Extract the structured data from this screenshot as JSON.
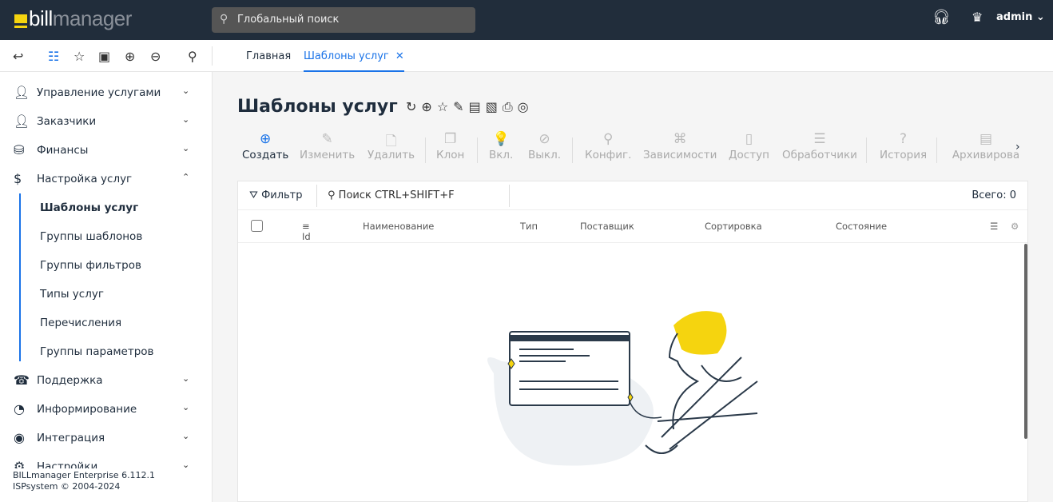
{
  "header": {
    "logo": "billmanager",
    "logo_bold": "bill",
    "logo_rest": "manager",
    "search_placeholder": "Глобальный поиск",
    "user": "admin"
  },
  "tabs": [
    {
      "label": "Главная"
    },
    {
      "label": "Шаблоны услуг",
      "active": true
    }
  ],
  "sidebar": {
    "items": [
      {
        "label": "Управление услугами",
        "icon": "user-tie-icon",
        "expanded": false
      },
      {
        "label": "Заказчики",
        "icon": "customer-icon",
        "expanded": false
      },
      {
        "label": "Финансы",
        "icon": "coins-icon",
        "expanded": false
      },
      {
        "label": "Настройка услуг",
        "icon": "money-bag-icon",
        "expanded": true
      },
      {
        "label": "Поддержка",
        "icon": "support-icon",
        "expanded": false
      },
      {
        "label": "Информирование",
        "icon": "pie-icon",
        "expanded": false
      },
      {
        "label": "Интеграция",
        "icon": "integration-icon",
        "expanded": false
      },
      {
        "label": "Настройки",
        "icon": "settings-icon",
        "expanded": false
      }
    ],
    "subitems": [
      "Шаблоны услуг",
      "Группы шаблонов",
      "Группы фильтров",
      "Типы услуг",
      "Перечисления",
      "Группы параметров"
    ],
    "footer_version": "BILLmanager Enterprise 6.112.1",
    "footer_copy": "ISPsystem © 2004-2024"
  },
  "page": {
    "title": "Шаблоны услуг",
    "actions": [
      {
        "label": "Создать",
        "icon": "⊕",
        "enabled": true
      },
      {
        "label": "Изменить",
        "icon": "✎"
      },
      {
        "label": "Удалить",
        "icon": "🗋"
      },
      {
        "label": "Клон",
        "icon": "❐"
      },
      {
        "label": "Вкл.",
        "icon": "💡"
      },
      {
        "label": "Выкл.",
        "icon": "⊘"
      },
      {
        "label": "Конфиг.",
        "icon": "⚲"
      },
      {
        "label": "Зависимости",
        "icon": "⌘"
      },
      {
        "label": "Доступ",
        "icon": "▯"
      },
      {
        "label": "Обработчики",
        "icon": "☰"
      },
      {
        "label": "История",
        "icon": "?"
      },
      {
        "label": "Архивирова",
        "icon": "▤"
      }
    ],
    "filter_label": "Фильтр",
    "search_placeholder": "Поиск CTRL+SHIFT+F",
    "total": "Всего: 0",
    "columns": [
      "Id",
      "Наименование",
      "Тип",
      "Поставщик",
      "Сортировка",
      "Состояние"
    ]
  },
  "colors": {
    "accent": "#1a73e8",
    "header_bg": "#212d3b",
    "logo_yellow": "#f5d40f"
  }
}
